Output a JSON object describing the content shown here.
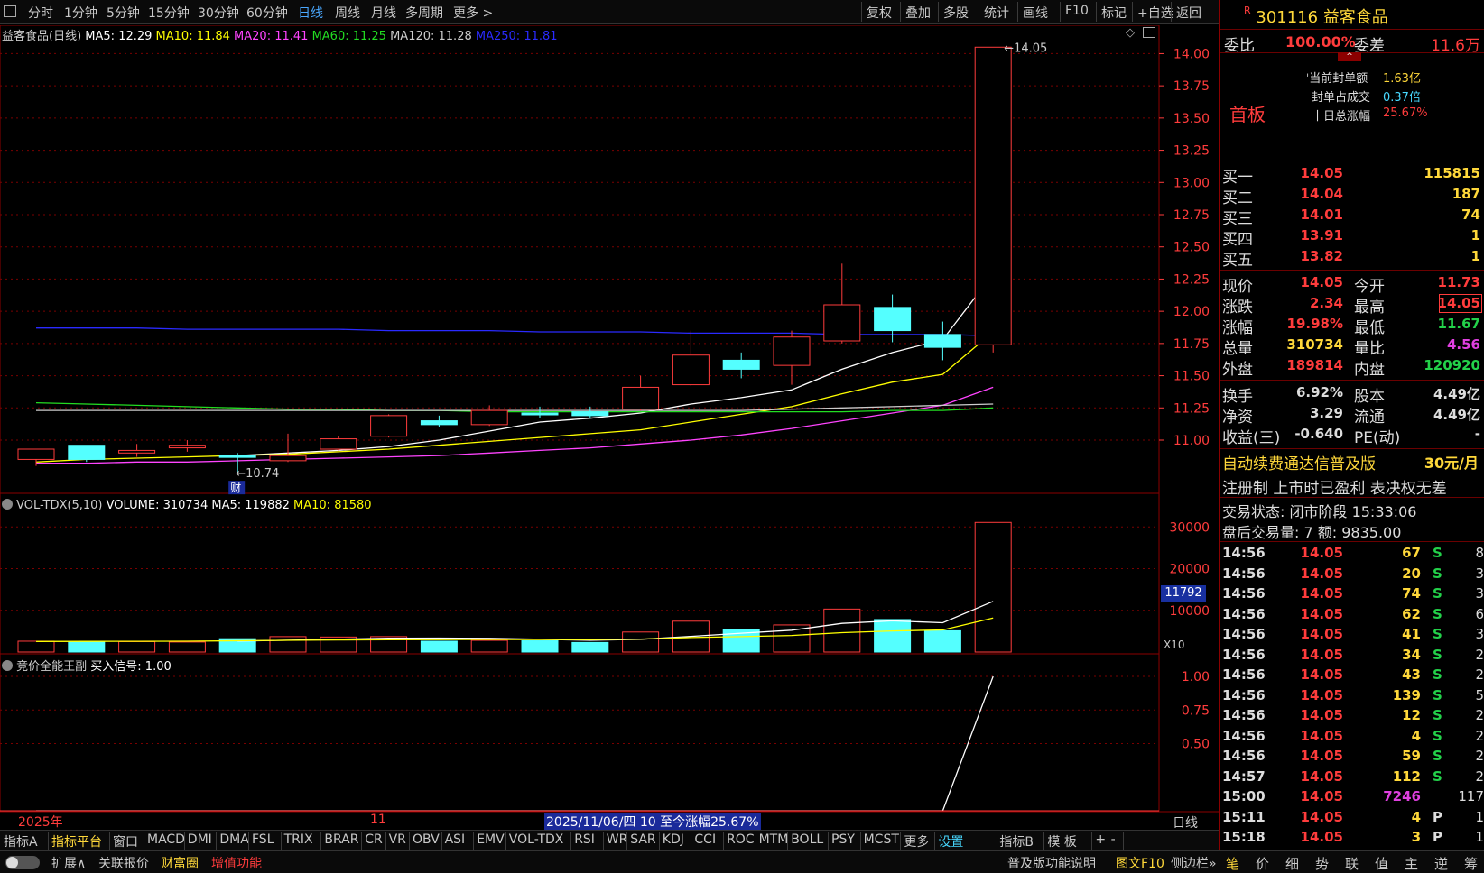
{
  "toolbar": {
    "periods": [
      "分时",
      "1分钟",
      "5分钟",
      "15分钟",
      "30分钟",
      "60分钟",
      "日线",
      "周线",
      "月线",
      "多周期",
      "更多 >"
    ],
    "active": "日线",
    "right": [
      "复权",
      "叠加",
      "多股",
      "统计",
      "画线",
      "F10",
      "标记",
      "+自选",
      "返回"
    ]
  },
  "main_chart": {
    "title": "益客食品(日线)",
    "ma_labels": [
      {
        "text": "MA5: 12.29",
        "color": "#ffffff"
      },
      {
        "text": "MA10: 11.84",
        "color": "#ffff00"
      },
      {
        "text": "MA20: 11.41",
        "color": "#ff44ff"
      },
      {
        "text": "MA60: 11.25",
        "color": "#22dd22"
      },
      {
        "text": "MA120: 11.28",
        "color": "#cccccc"
      },
      {
        "text": "MA250: 11.81",
        "color": "#2a2aff"
      }
    ],
    "high_label": "14.05",
    "low_label": "10.74",
    "fin_marker": "财"
  },
  "vol_chart": {
    "title": "VOL-TDX(5,10)",
    "volume": "VOLUME: 310734",
    "ma5": "MA5: 119882",
    "ma10": "MA10: 81580",
    "cursor_value": "11792",
    "unit": "X10"
  },
  "sig_chart": {
    "title": "竞价全能王副",
    "signal": "买入信号: 1.00"
  },
  "time_axis": {
    "year": "2025年",
    "month": "11",
    "info": "2025/11/06/四 10 至今涨幅25.67%",
    "period": "日线"
  },
  "chart_data": [
    {
      "type": "candlestick",
      "name": "益客食品(日线)",
      "ylim": [
        10.7,
        14.15
      ],
      "y_ticks": [
        "14.00",
        "13.75",
        "13.50",
        "13.25",
        "13.00",
        "12.75",
        "12.50",
        "12.25",
        "12.00",
        "11.75",
        "11.50",
        "11.25",
        "11.00"
      ],
      "candles": [
        {
          "o": 10.85,
          "c": 10.93,
          "h": 10.93,
          "l": 10.8
        },
        {
          "o": 10.96,
          "c": 10.85,
          "h": 10.96,
          "l": 10.83
        },
        {
          "o": 10.9,
          "c": 10.92,
          "h": 10.97,
          "l": 10.87
        },
        {
          "o": 10.94,
          "c": 10.96,
          "h": 11.0,
          "l": 10.91
        },
        {
          "o": 10.88,
          "c": 10.87,
          "h": 10.9,
          "l": 10.74
        },
        {
          "o": 10.84,
          "c": 10.88,
          "h": 11.05,
          "l": 10.83
        },
        {
          "o": 10.93,
          "c": 11.01,
          "h": 11.03,
          "l": 10.92
        },
        {
          "o": 11.03,
          "c": 11.19,
          "h": 11.2,
          "l": 11.02
        },
        {
          "o": 11.15,
          "c": 11.12,
          "h": 11.19,
          "l": 11.1
        },
        {
          "o": 11.12,
          "c": 11.23,
          "h": 11.27,
          "l": 11.11
        },
        {
          "o": 11.21,
          "c": 11.2,
          "h": 11.26,
          "l": 11.17
        },
        {
          "o": 11.22,
          "c": 11.19,
          "h": 11.26,
          "l": 11.17
        },
        {
          "o": 11.24,
          "c": 11.41,
          "h": 11.5,
          "l": 11.23
        },
        {
          "o": 11.43,
          "c": 11.66,
          "h": 11.85,
          "l": 11.42
        },
        {
          "o": 11.62,
          "c": 11.55,
          "h": 11.68,
          "l": 11.48
        },
        {
          "o": 11.58,
          "c": 11.8,
          "h": 11.85,
          "l": 11.43
        },
        {
          "o": 11.77,
          "c": 12.05,
          "h": 12.37,
          "l": 11.75
        },
        {
          "o": 12.03,
          "c": 11.85,
          "h": 12.13,
          "l": 11.76
        },
        {
          "o": 11.82,
          "c": 11.72,
          "h": 11.92,
          "l": 11.62
        },
        {
          "o": 11.74,
          "c": 14.05,
          "h": 14.05,
          "l": 11.68
        }
      ],
      "ma_lines": [
        {
          "name": "MA5",
          "color": "#ffffff",
          "values": [
            null,
            null,
            null,
            null,
            10.88,
            10.9,
            10.92,
            10.95,
            11.0,
            11.07,
            11.14,
            11.17,
            11.21,
            11.28,
            11.33,
            11.39,
            11.55,
            11.68,
            11.78,
            12.29
          ]
        },
        {
          "name": "MA10",
          "color": "#ffff00",
          "values": [
            10.83,
            10.85,
            10.86,
            10.87,
            10.88,
            10.89,
            10.91,
            10.93,
            10.96,
            10.99,
            11.02,
            11.05,
            11.08,
            11.14,
            11.2,
            11.26,
            11.36,
            11.45,
            11.51,
            11.84
          ]
        },
        {
          "name": "MA20",
          "color": "#ff44ff",
          "values": [
            10.82,
            10.82,
            10.83,
            10.83,
            10.84,
            10.85,
            10.86,
            10.87,
            10.88,
            10.9,
            10.92,
            10.94,
            10.97,
            11.0,
            11.04,
            11.09,
            11.15,
            11.21,
            11.27,
            11.41
          ]
        },
        {
          "name": "MA60",
          "color": "#22dd22",
          "values": [
            11.29,
            11.28,
            11.27,
            11.26,
            11.25,
            11.24,
            11.24,
            11.23,
            11.23,
            11.22,
            11.22,
            11.22,
            11.22,
            11.22,
            11.22,
            11.22,
            11.22,
            11.23,
            11.23,
            11.25
          ]
        },
        {
          "name": "MA120",
          "color": "#cccccc",
          "values": [
            11.23,
            11.23,
            11.23,
            11.23,
            11.23,
            11.23,
            11.23,
            11.23,
            11.23,
            11.23,
            11.23,
            11.23,
            11.23,
            11.23,
            11.23,
            11.24,
            11.25,
            11.26,
            11.27,
            11.28
          ]
        },
        {
          "name": "MA250",
          "color": "#2a2aff",
          "values": [
            11.87,
            11.87,
            11.87,
            11.86,
            11.86,
            11.86,
            11.86,
            11.85,
            11.85,
            11.85,
            11.84,
            11.84,
            11.84,
            11.83,
            11.83,
            11.83,
            11.82,
            11.82,
            11.82,
            11.81
          ]
        }
      ]
    },
    {
      "type": "bar",
      "name": "VOL-TDX(5,10)",
      "ylim": [
        0,
        32000
      ],
      "y_ticks": [
        "30000",
        "20000",
        "10000"
      ],
      "values": [
        2600,
        2400,
        2500,
        2400,
        3200,
        3700,
        3600,
        3700,
        2600,
        2800,
        2700,
        2300,
        4800,
        7400,
        5400,
        6500,
        10300,
        7800,
        5100,
        31073
      ],
      "up": [
        true,
        false,
        true,
        true,
        false,
        true,
        true,
        true,
        false,
        true,
        false,
        false,
        true,
        true,
        false,
        true,
        true,
        false,
        false,
        true
      ],
      "ma5": [
        null,
        null,
        null,
        null,
        2620,
        2840,
        3080,
        3320,
        3360,
        3280,
        3080,
        2820,
        3040,
        3760,
        4520,
        5240,
        6880,
        7480,
        7020,
        12155
      ],
      "ma10": [
        2540,
        2560,
        2580,
        2600,
        2700,
        2800,
        2900,
        2960,
        2990,
        3010,
        3010,
        2990,
        3110,
        3480,
        3700,
        3980,
        4640,
        5050,
        5300,
        8158
      ]
    },
    {
      "type": "line",
      "name": "竞价全能王副",
      "ylim": [
        0,
        1.1
      ],
      "y_ticks": [
        "1.00",
        "0.75",
        "0.50"
      ],
      "values": [
        0,
        0,
        0,
        0,
        0,
        0,
        0,
        0,
        0,
        0,
        0,
        0,
        0,
        0,
        0,
        0,
        0,
        0,
        0,
        1.0
      ]
    }
  ],
  "quote": {
    "code": "301116",
    "name": "益客食品",
    "r_mark": "R",
    "wb_label": "委比",
    "wb_value": "100.00%",
    "wc_label": "委差",
    "wc_value": "11.6万",
    "seal_amount_label": "当前封单额",
    "seal_amount": "1.63亿",
    "seal_ratio_label": "封单占成交",
    "seal_ratio": "0.37倍",
    "ten_day_label": "十日总涨幅",
    "ten_day": "25.67%",
    "board": "首板",
    "bids": [
      {
        "label": "买一",
        "price": "14.05",
        "vol": "115815"
      },
      {
        "label": "买二",
        "price": "14.04",
        "vol": "187"
      },
      {
        "label": "买三",
        "price": "14.01",
        "vol": "74"
      },
      {
        "label": "买四",
        "price": "13.91",
        "vol": "1"
      },
      {
        "label": "买五",
        "price": "13.82",
        "vol": "1"
      }
    ],
    "stats": [
      {
        "l1": "现价",
        "v1": "14.05",
        "c1": "red",
        "l2": "今开",
        "v2": "11.73",
        "c2": "red"
      },
      {
        "l1": "涨跌",
        "v1": "2.34",
        "c1": "red",
        "l2": "最高",
        "v2": "14.05",
        "c2": "red",
        "box": true
      },
      {
        "l1": "涨幅",
        "v1": "19.98%",
        "c1": "red",
        "l2": "最低",
        "v2": "11.67",
        "c2": "grn"
      },
      {
        "l1": "总量",
        "v1": "310734",
        "c1": "yel",
        "l2": "量比",
        "v2": "4.56",
        "c2": "mag"
      },
      {
        "l1": "外盘",
        "v1": "189814",
        "c1": "red",
        "l2": "内盘",
        "v2": "120920",
        "c2": "grn"
      }
    ],
    "fund": [
      {
        "l1": "换手",
        "v1": "6.92%",
        "l2": "股本",
        "v2": "4.49亿"
      },
      {
        "l1": "净资",
        "v1": "3.29",
        "l2": "流通",
        "v2": "4.49亿"
      },
      {
        "l1": "收益(三)",
        "v1": "-0.640",
        "l2": "PE(动)",
        "v2": "-"
      }
    ],
    "promo": "自动续费通达信普及版",
    "promo_price": "30元/月",
    "tags": "注册制 上市时已盈利 表决权无差",
    "trade_state": "交易状态: 闭市阶段 15:33:06",
    "after_hours": "盘后交易量: 7 额: 9835.00",
    "ticks": [
      {
        "t": "14:56",
        "p": "14.05",
        "v": "67",
        "d": "S",
        "n": "8"
      },
      {
        "t": "14:56",
        "p": "14.05",
        "v": "20",
        "d": "S",
        "n": "3"
      },
      {
        "t": "14:56",
        "p": "14.05",
        "v": "74",
        "d": "S",
        "n": "3"
      },
      {
        "t": "14:56",
        "p": "14.05",
        "v": "62",
        "d": "S",
        "n": "6"
      },
      {
        "t": "14:56",
        "p": "14.05",
        "v": "41",
        "d": "S",
        "n": "3"
      },
      {
        "t": "14:56",
        "p": "14.05",
        "v": "34",
        "d": "S",
        "n": "2"
      },
      {
        "t": "14:56",
        "p": "14.05",
        "v": "43",
        "d": "S",
        "n": "2"
      },
      {
        "t": "14:56",
        "p": "14.05",
        "v": "139",
        "d": "S",
        "n": "5"
      },
      {
        "t": "14:56",
        "p": "14.05",
        "v": "12",
        "d": "S",
        "n": "2"
      },
      {
        "t": "14:56",
        "p": "14.05",
        "v": "4",
        "d": "S",
        "n": "2"
      },
      {
        "t": "14:56",
        "p": "14.05",
        "v": "59",
        "d": "S",
        "n": "2"
      },
      {
        "t": "14:57",
        "p": "14.05",
        "v": "112",
        "d": "S",
        "n": "2"
      },
      {
        "t": "15:00",
        "p": "14.05",
        "v": "7246",
        "d": "",
        "n": "117",
        "vc": "mag"
      },
      {
        "t": "15:11",
        "p": "14.05",
        "v": "4",
        "d": "P",
        "n": "1"
      },
      {
        "t": "15:18",
        "p": "14.05",
        "v": "3",
        "d": "P",
        "n": "1"
      }
    ],
    "tabs": [
      "笔",
      "价",
      "细",
      "势",
      "联",
      "值",
      "主",
      "逆",
      "筹"
    ]
  },
  "indicator_tabs": [
    "指标A",
    "指标平台",
    "窗口",
    "MACD",
    "DMI",
    "DMA",
    "FSL",
    "TRIX",
    "BRAR",
    "CR",
    "VR",
    "OBV",
    "ASI",
    "EMV",
    "VOL-TDX",
    "RSI",
    "WR",
    "SAR",
    "KDJ",
    "CCI",
    "ROC",
    "MTM",
    "BOLL",
    "PSY",
    "MCST",
    "更多",
    "设置",
    "指标B",
    "模 板",
    "+",
    "-"
  ],
  "status_items": [
    {
      "text": "扩展∧",
      "color": "#ccc"
    },
    {
      "text": "关联报价",
      "color": "#ccc"
    },
    {
      "text": "财富圈",
      "color": "#ffd83a"
    },
    {
      "text": "增值功能",
      "color": "#ff3c3c"
    },
    {
      "text": "普及版功能说明",
      "color": "#ccc"
    },
    {
      "text": "图文F10",
      "color": "#ffd83a"
    },
    {
      "text": "侧边栏»",
      "color": "#ccc"
    }
  ]
}
